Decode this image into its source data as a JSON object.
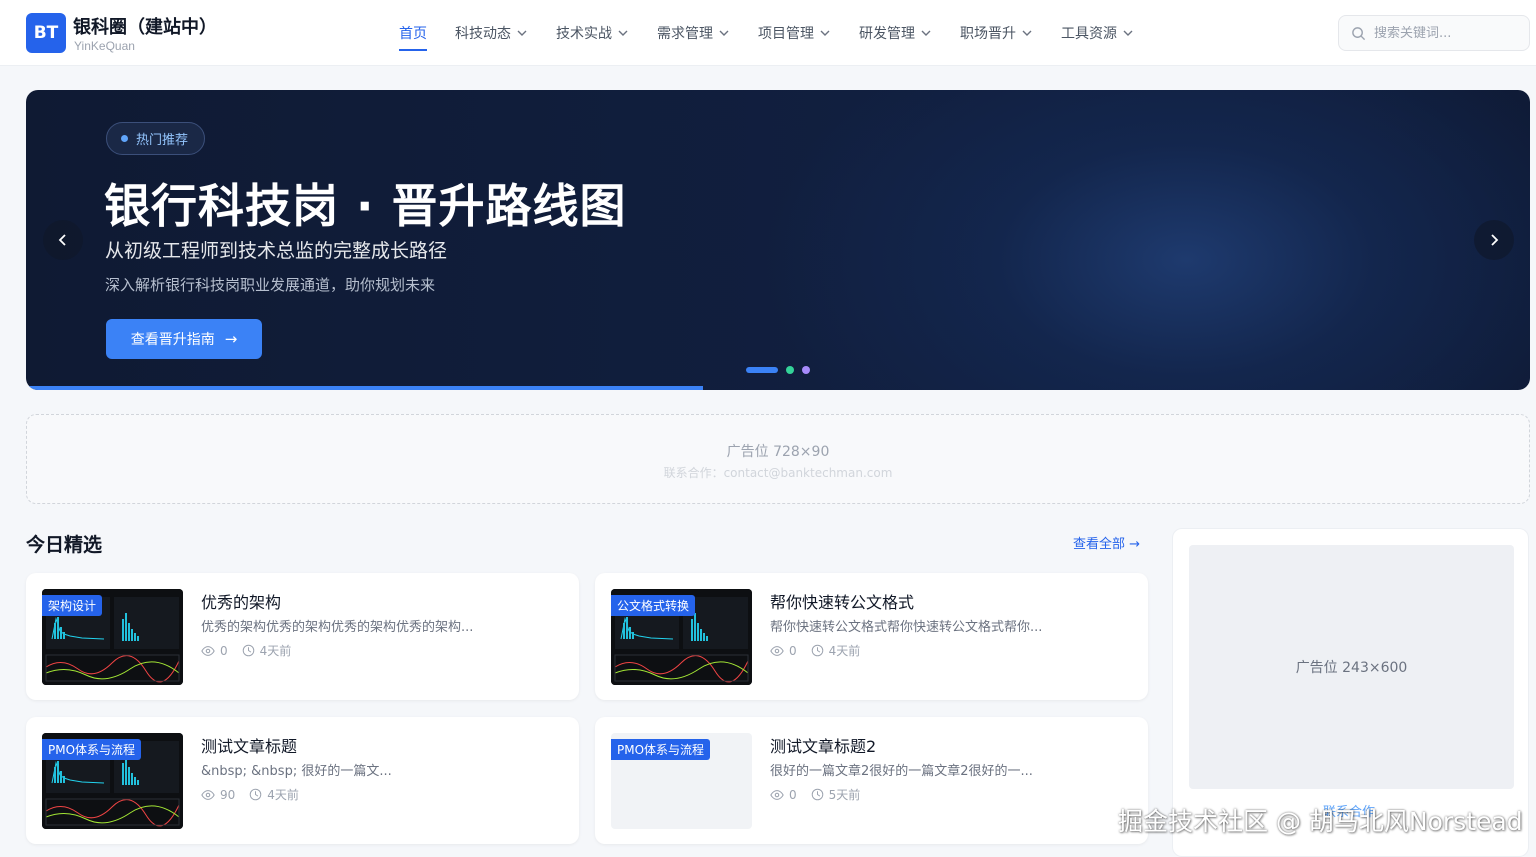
{
  "header": {
    "logo_text": "BT",
    "brand_name": "银科圈（建站中）",
    "brand_sub": "YinKeQuan",
    "nav": [
      {
        "label": "首页",
        "active": true
      },
      {
        "label": "科技动态"
      },
      {
        "label": "技术实战"
      },
      {
        "label": "需求管理"
      },
      {
        "label": "项目管理"
      },
      {
        "label": "研发管理"
      },
      {
        "label": "职场晋升"
      },
      {
        "label": "工具资源"
      }
    ],
    "search_placeholder": "搜索关键词..."
  },
  "hero": {
    "badge": "热门推荐",
    "title": "银行科技岗 · 晋升路线图",
    "subtitle": "从初级工程师到技术总监的完整成长路径",
    "description": "深入解析银行科技岗职业发展通道，助你规划未来",
    "button_label": "查看晋升指南",
    "button_arrow": "→",
    "slides": 3,
    "active_slide": 1,
    "progress": 0.45,
    "dot_colors": [
      "#3b82f6",
      "#34d399",
      "#a78bfa"
    ]
  },
  "ad_top": {
    "label": "广告位 728×90",
    "contact": "联系合作：contact@banktechman.com"
  },
  "section": {
    "title": "今日精选",
    "view_all": "查看全部 →"
  },
  "articles": [
    {
      "tag": "架构设计",
      "title": "优秀的架构",
      "excerpt": "优秀的架构优秀的架构优秀的架构优秀的架构...",
      "views": "0",
      "time": "4天前",
      "thumb": "chart"
    },
    {
      "tag": "公文格式转换",
      "title": "帮你快速转公文格式",
      "excerpt": "帮你快速转公文格式帮你快速转公文格式帮你...",
      "views": "0",
      "time": "4天前",
      "thumb": "chart"
    },
    {
      "tag": "PMO体系与流程",
      "title": "测试文章标题",
      "excerpt": "&nbsp; &nbsp; 很好的一篇文...",
      "views": "90",
      "time": "4天前",
      "thumb": "chart"
    },
    {
      "tag": "PMO体系与流程",
      "title": "测试文章标题2",
      "excerpt": "很好的一篇文章2很好的一篇文章2很好的一...",
      "views": "0",
      "time": "5天前",
      "thumb": "empty"
    }
  ],
  "sidebar": {
    "ad_label": "广告位 243×600",
    "link": "联系合作"
  },
  "watermark": "掘金技术社区 @ 胡马北风Norstead"
}
